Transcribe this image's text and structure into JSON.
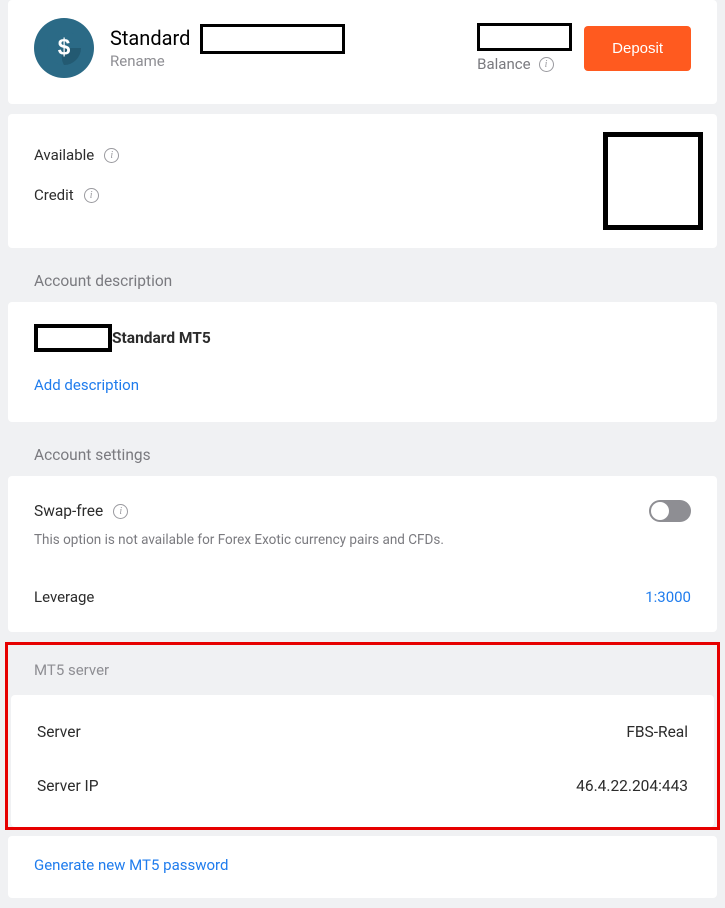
{
  "header": {
    "title": "Standard",
    "rename_label": "Rename",
    "balance_label": "Balance",
    "deposit_label": "Deposit"
  },
  "stats": {
    "available_label": "Available",
    "credit_label": "Credit"
  },
  "description": {
    "section_label": "Account description",
    "title": "Standard MT5",
    "add_label": "Add description"
  },
  "settings": {
    "section_label": "Account settings",
    "swap_free_label": "Swap-free",
    "swap_note": "This option is not available for Forex Exotic currency pairs and CFDs.",
    "leverage_label": "Leverage",
    "leverage_value": "1:3000"
  },
  "mt5": {
    "section_label": "MT5 server",
    "server_label": "Server",
    "server_value": "FBS-Real",
    "server_ip_label": "Server IP",
    "server_ip_value": "46.4.22.204:443",
    "generate_password_label": "Generate new MT5 password"
  }
}
